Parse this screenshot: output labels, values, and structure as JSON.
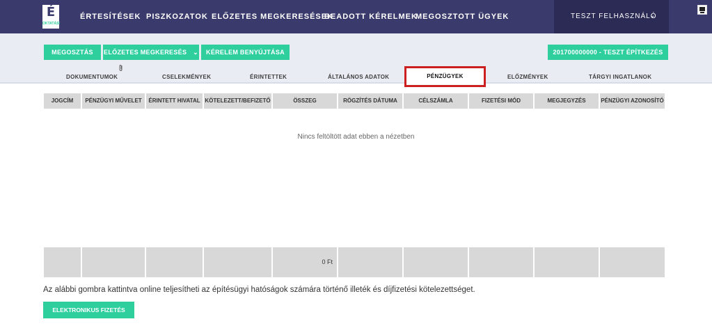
{
  "logo": {
    "letter": "É",
    "subtitle": "OKTATÁSI"
  },
  "nav": {
    "items": [
      "ÉRTESÍTÉSEK",
      "PISZKOZATOK",
      "ELŐZETES MEGKERESÉSEK",
      "BEADOTT KÉRELMEK",
      "MEGOSZTOTT ÜGYEK"
    ],
    "user": "TESZT FELHASZNÁLÓ",
    "user_chevron": "⌄"
  },
  "actions": {
    "share": "MEGOSZTÁS",
    "prior": "ELŐZETES MEGKERESÉS",
    "prior_chevron": "⌄",
    "submit": "KÉRELEM BENYÚJTÁSA",
    "case": "201700000000 - TESZT ÉPÍTKEZÉS"
  },
  "tabs": {
    "documents": "DOKUMENTUMOK",
    "actions": "CSELEKMÉNYEK",
    "affected": "ÉRINTETTEK",
    "general": "ÁLTALÁNOS ADATOK",
    "finances": "PÉNZÜGYEK",
    "history": "ELŐZMÉNYEK",
    "property": "TÁRGYI INGATLANOK"
  },
  "table": {
    "headers": [
      "JOGCÍM",
      "PÉNZÜGYI MŰVELET",
      "ÉRINTETT HIVATAL",
      "KÖTELEZETT/BEFIZETŐ",
      "ÖSSZEG",
      "RÖGZÍTÉS DÁTUMA",
      "CÉLSZÁMLA",
      "FIZETÉSI MÓD",
      "MEGJEGYZÉS",
      "PÉNZÜGYI AZONOSÍTÓ"
    ],
    "empty_message": "Nincs feltöltött adat ebben a nézetben",
    "total": "0 Ft"
  },
  "payment": {
    "note": "Az alábbi gombra kattintva online teljesítheti az építésügyi hatóságok számára történő illeték és díjfizetési kötelezettséget.",
    "button": "ELEKTRONIKUS FIZETÉS"
  },
  "colors": {
    "nav_bg": "#3b3a6d",
    "accent": "#2ecf9d",
    "highlight": "#cc1f1f"
  }
}
